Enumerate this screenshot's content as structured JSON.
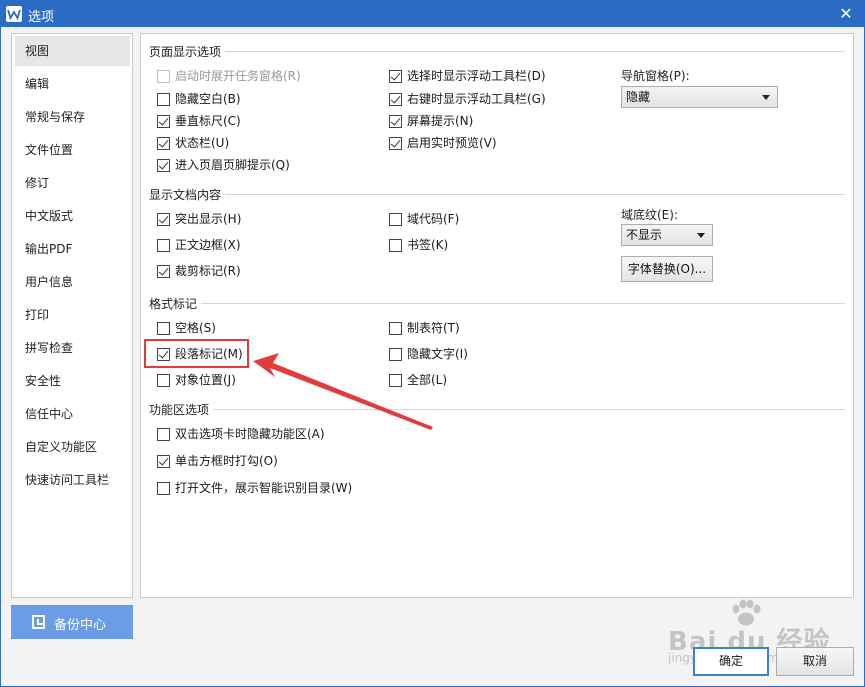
{
  "window": {
    "title": "选项",
    "accent_color": "#2b6cc4",
    "icon": "wps-writer-icon"
  },
  "sidebar": {
    "items": [
      {
        "label": "视图",
        "active": true
      },
      {
        "label": "编辑"
      },
      {
        "label": "常规与保存"
      },
      {
        "label": "文件位置"
      },
      {
        "label": "修订"
      },
      {
        "label": "中文版式"
      },
      {
        "label": "输出PDF"
      },
      {
        "label": "用户信息"
      },
      {
        "label": "打印"
      },
      {
        "label": "拼写检查"
      },
      {
        "label": "安全性"
      },
      {
        "label": "信任中心"
      },
      {
        "label": "自定义功能区"
      },
      {
        "label": "快速访问工具栏"
      }
    ],
    "backup_button": "备份中心"
  },
  "sections": {
    "page_display": {
      "title": "页面显示选项",
      "options": [
        {
          "label": "启动时展开任务窗格(R)",
          "checked": false,
          "disabled": true
        },
        {
          "label": "隐藏空白(B)",
          "checked": false
        },
        {
          "label": "垂直标尺(C)",
          "checked": true
        },
        {
          "label": "状态栏(U)",
          "checked": true
        },
        {
          "label": "进入页眉页脚提示(Q)",
          "checked": true
        },
        {
          "label": "选择时显示浮动工具栏(D)",
          "checked": true
        },
        {
          "label": "右键时显示浮动工具栏(G)",
          "checked": true
        },
        {
          "label": "屏幕提示(N)",
          "checked": true
        },
        {
          "label": "启用实时预览(V)",
          "checked": true
        }
      ],
      "nav_pane_label": "导航窗格(P):",
      "nav_pane_value": "隐藏"
    },
    "doc_content": {
      "title": "显示文档内容",
      "options": [
        {
          "label": "突出显示(H)",
          "checked": true
        },
        {
          "label": "正文边框(X)",
          "checked": false
        },
        {
          "label": "裁剪标记(R)",
          "checked": true
        },
        {
          "label": "域代码(F)",
          "checked": false
        },
        {
          "label": "书签(K)",
          "checked": false
        }
      ],
      "field_shading_label": "域底纹(E):",
      "field_shading_value": "不显示",
      "font_replace_button": "字体替换(O)..."
    },
    "format_marks": {
      "title": "格式标记",
      "options": [
        {
          "label": "空格(S)",
          "checked": false
        },
        {
          "label": "段落标记(M)",
          "checked": true
        },
        {
          "label": "对象位置(J)",
          "checked": false
        },
        {
          "label": "制表符(T)",
          "checked": false
        },
        {
          "label": "隐藏文字(I)",
          "checked": false
        },
        {
          "label": "全部(L)",
          "checked": false
        }
      ]
    },
    "ribbon": {
      "title": "功能区选项",
      "options": [
        {
          "label": "双击选项卡时隐藏功能区(A)",
          "checked": false
        },
        {
          "label": "单击方框时打勾(O)",
          "checked": true
        },
        {
          "label": "打开文件，展示智能识别目录(W)",
          "checked": false
        }
      ]
    }
  },
  "footer": {
    "ok": "确定",
    "cancel": "取消"
  },
  "annotation": {
    "highlight_color": "#e23b3b"
  },
  "watermark": {
    "brand": "Bai du 经验",
    "url": "jingyan.baidu.com"
  }
}
